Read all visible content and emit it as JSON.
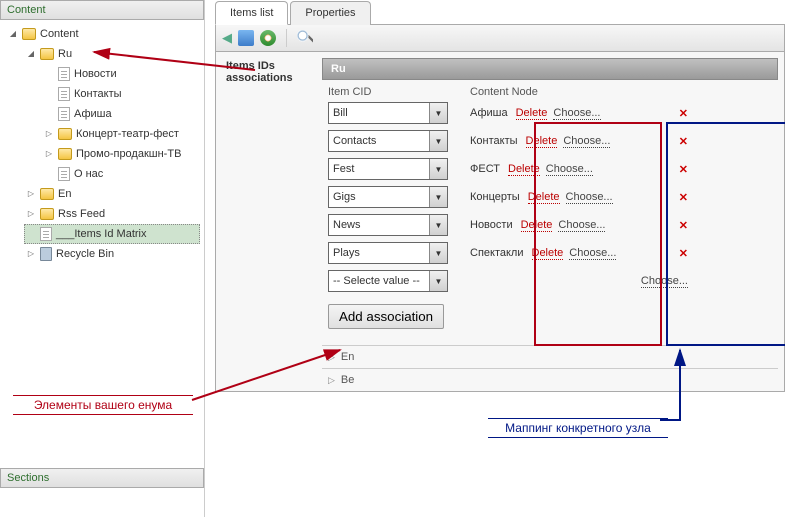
{
  "left": {
    "content_header": "Content",
    "sections_header": "Sections",
    "root": "Content",
    "ru": "Ru",
    "ru_children": [
      "Новости",
      "Контакты",
      "Афиша",
      "Концерт-театр-фест",
      "Промо-продакшн-ТВ",
      "О нас"
    ],
    "en": "En",
    "rss": "Rss Feed",
    "matrix": "___Items Id Matrix",
    "recycle": "Recycle Bin"
  },
  "tabs": {
    "items": "Items list",
    "props": "Properties"
  },
  "assoc": {
    "title": "Items IDs associations",
    "header": "Ru",
    "col_cid": "Item CID",
    "col_node": "Content Node",
    "rows": [
      {
        "cid": "Bill",
        "node": "Афиша",
        "del": "Delete",
        "choose": "Choose..."
      },
      {
        "cid": "Contacts",
        "node": "Контакты",
        "del": "Delete",
        "choose": "Choose..."
      },
      {
        "cid": "Fest",
        "node": "ФЕСТ",
        "del": "Delete",
        "choose": "Choose..."
      },
      {
        "cid": "Gigs",
        "node": "Концерты",
        "del": "Delete",
        "choose": "Choose..."
      },
      {
        "cid": "News",
        "node": "Новости",
        "del": "Delete",
        "choose": "Choose..."
      },
      {
        "cid": "Plays",
        "node": "Спектакли",
        "del": "Delete",
        "choose": "Choose..."
      }
    ],
    "empty_select": "-- Selecte value --",
    "empty_choose": "Choose...",
    "add_btn": "Add association",
    "sub": [
      "En",
      "Be"
    ]
  },
  "annotations": {
    "enum_label": "Элементы вашего енума",
    "mapping_label": "Маппинг конкретного узла"
  }
}
